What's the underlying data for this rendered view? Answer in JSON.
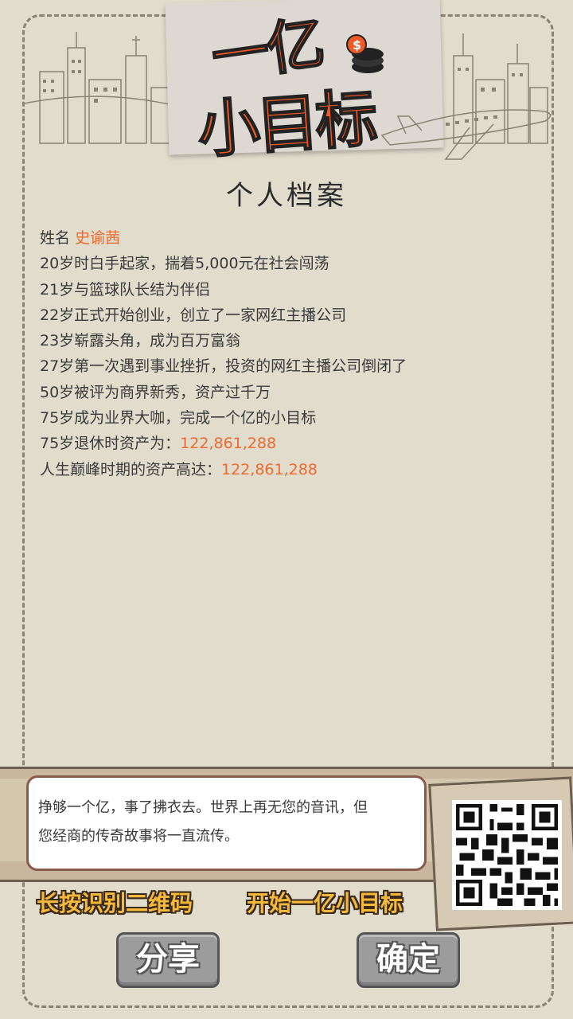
{
  "header": {
    "title_line1": "一亿",
    "title_line2": "小目标"
  },
  "section_title": "个人档案",
  "profile": {
    "name_label": "姓名",
    "name_value": "史谕茜",
    "events": [
      "20岁时白手起家，揣着5,000元在社会闯荡",
      "21岁与篮球队长结为伴侣",
      "22岁正式开始创业，创立了一家网红主播公司",
      "23岁崭露头角，成为百万富翁",
      "27岁第一次遇到事业挫折，投资的网红主播公司倒闭了",
      "50岁被评为商界新秀，资产过千万",
      "75岁成为业界大咖，完成一个亿的小目标"
    ],
    "retire_label": "75岁退休时资产为：",
    "retire_value": "122,861,288",
    "peak_label": "人生巅峰时期的资产高达：",
    "peak_value": "122,861,288"
  },
  "message": {
    "line1": "挣够一个亿，事了拂衣去。世界上再无您的音讯，但",
    "line2": "您经商的传奇故事将一直流传。"
  },
  "labels": {
    "qr_hint": "长按识别二维码",
    "start_goal": "开始一亿小目标"
  },
  "buttons": {
    "share": "分享",
    "confirm": "确定"
  },
  "colors": {
    "accent": "#f15a22",
    "highlight": "#ee6a2e",
    "label_yellow": "#f6b93b",
    "background": "#e2dccd"
  }
}
